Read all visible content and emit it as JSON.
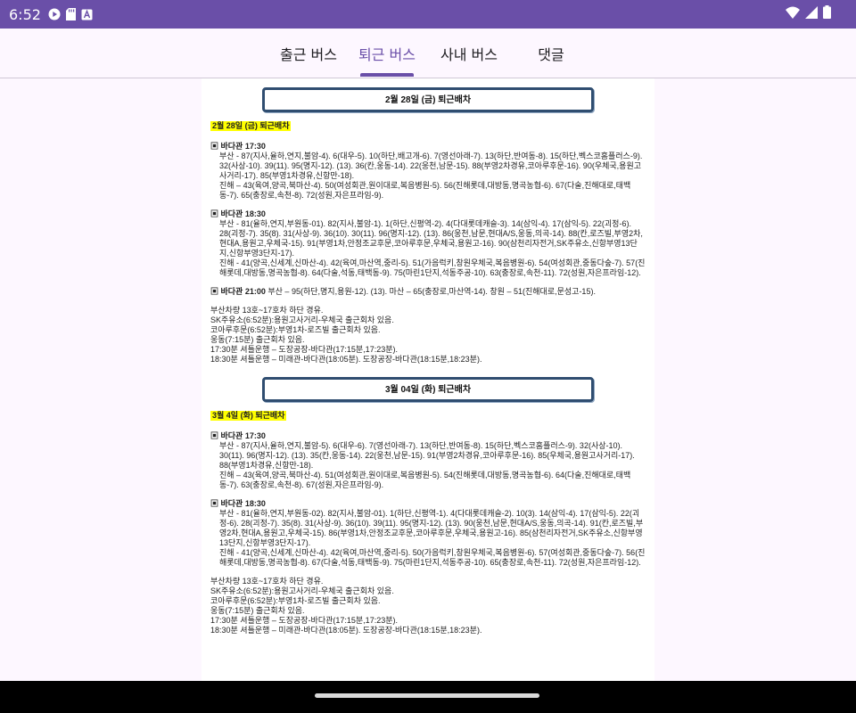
{
  "status": {
    "time": "6:52"
  },
  "tabs": [
    {
      "label": "출근 버스",
      "active": false
    },
    {
      "label": "퇴근 버스",
      "active": true
    },
    {
      "label": "사내 버스",
      "active": false
    },
    {
      "label": "댓글",
      "active": false
    }
  ],
  "colors": {
    "accent": "#6a4fa8",
    "banner_border": "#2f4d70",
    "highlight": "#ffff00"
  },
  "sections": [
    {
      "banner": "2월        28일 (금) 퇴근배차",
      "highlight": "2월          28일 (금)    퇴근배차",
      "blocks": [
        {
          "heading": "▣ 바다관 17:30",
          "lines": [
            "부산 - 87(지사,율하,연지,불암-4).  6(대우-5).  10(하단,배고개-6).  7(영선아래-7).  13(하단,반여동-8).  15(하단,벡스코홈플러스-9).  32(사상-10).  39(11).  95(명지-12).  (13).  36(칸,웅동-14).  22(웅천,남문-15).  88(부영2차경유,코아루후문-16).  90(우체국,용원고사거리-17).   85(부영1차경유,신항만-18).",
            "진해 – 43(육여,양곡,북마산-4).  50(여성회관,원이대로,복음병원-5).  56(진해롯데,대방동,명곡농협-6).  67(다술,진해대로,태백동-7).  65(충장로,속천-8).  72(성원,자은프라임-9)."
          ]
        },
        {
          "heading": "▣ 바다관 18:30",
          "lines": [
            "부산 - 81(율하,연지,부원동-01).  82(지사,불암-1).  1(하단,신평역-2).  4(다대롯데캐슬-3).  14(삼익-4).  17(삼익-5).  22(괴정-6).  28(괴정-7).  35(8).  31(사상-9).  36(10).  30(11).  96(명지-12).  (13).  86(웅천,남문,현대A/S,웅동,의곡-14).  88(칸,로즈빌,부영2차,현대A,용원고,우체국-15).  91(부영1차,안정조교후문,코아루후문,우체국,용원고-16).  90(삼천리자전거,SK주유소,신항부영13단지,신항부영3단지-17).",
            "진해 - 41(양곡,신세계,신마산-4).  42(육여,마산역,중리-5).  51(가음럭키,창원우체국,복음병원-6).  54(여성회관,중동다숲-7).  57(진해롯데,대방동,명곡농협-8).  64(다술,석동,태백동-9).  75(마린1단지,석동주공-10).  63(충장로,속천-11).  72(성원,자은프라임-12)."
          ]
        },
        {
          "heading": "▣ 바다관 21:00",
          "inline": " 부산 – 95(하단,명지,용원-12).  (13).  마산 – 65(충장로,마산역-14).  창원 – 51(진해대로,문성고-15)."
        }
      ],
      "notes": [
        "부산차량 13호~17호차 하단 경유.",
        "SK주유소(6:52분):용원고사거리-우체국  출근회차 있음.",
        "코아루후문(6:52분):부영1차-로즈빌  출근회차 있음.",
        "웅동(7:15분)  출근회차 있음.",
        "17:30분  셔틀운행  – 도장공장-바다관(17:15분,17:23분).",
        "18:30분  셔틀운행  – 미래관-바다관(18:05분).  도장공장-바다관(18:15분,18:23분)."
      ]
    },
    {
      "banner": "3월        04일 (화) 퇴근배차",
      "highlight": "3월          4일 (화)    퇴근배차",
      "blocks": [
        {
          "heading": "▣ 바다관 17:30",
          "lines": [
            "부산 - 87(지사,율하,연지,불암-5).  6(대우-6).  7(영선아래-7).  13(하단,반여동-8).  15(하단,벡스코홈플러스-9).  32(사상-10).  30(11).  96(명지-12).  (13).  35(칸,웅동-14).  22(웅천,남문-15).  91(부영2차경유,코아루후문-16).  85(우체국,용원고사거리-17).  88(부영1차경유,신항만-18).",
            "진해 – 43(육여,양곡,북마산-4).  51(여성회관,원이대로,복음병원-5).  54(진해롯데,대방동,명곡농협-6).  64(다술,진해대로,태백동-7).  63(충장로,속천-8).  67(성원,자은프라임-9)."
          ]
        },
        {
          "heading": "▣ 바다관 18:30",
          "lines": [
            "부산 - 81(율하,연지,부원동-02).  82(지사,불암-01).  1(하단,신평역-1).  4(다대롯데캐슬-2).  10(3).  14(삼익-4).  17(삼익-5).  22(괴정-6).  28(괴정-7).  35(8).  31(사상-9).  36(10).  39(11).  95(명지-12).  (13).  90(웅천,남문,현대A/S,웅동,의곡-14).  91(칸,로즈빌,부영2차,현대A,용원고,우체국-15).  86(부영1차,안정조교후문,코아루후문,우체국,용원고-16).  85(삼천리자전거,SK주유소,신항부영13단지,신항부영3단지-17).",
            "진해 - 41(양곡,신세계,신마산-4).  42(육여,마산역,중리-5).  50(가음럭키,창원우체국,복음병원-6).  57(여성회관,중동다숲-7).  56(진해롯데,대방동,명곡농협-8).  67(다술,석동,태백동-9).  75(마린1단지,석동주공-10).  65(충장로,속천-11).  72(성원,자은프라임-12)."
          ]
        }
      ],
      "notes": [
        "부산차량 13호~17호차 하단 경유.",
        "SK주유소(6:52분):용원고사거리-우체국  출근회차 있음.",
        "코아루후문(6:52분):부영1차-로즈빌  출근회차 있음.",
        "웅동(7:15분)  출근회차 있음.",
        "17:30분  셔틀운행  – 도장공장-바다관(17:15분,17:23분).",
        "18:30분  셔틀운행  – 미래관-바다관(18:05분).  도장공장-바다관(18:15분,18:23분)."
      ]
    }
  ]
}
